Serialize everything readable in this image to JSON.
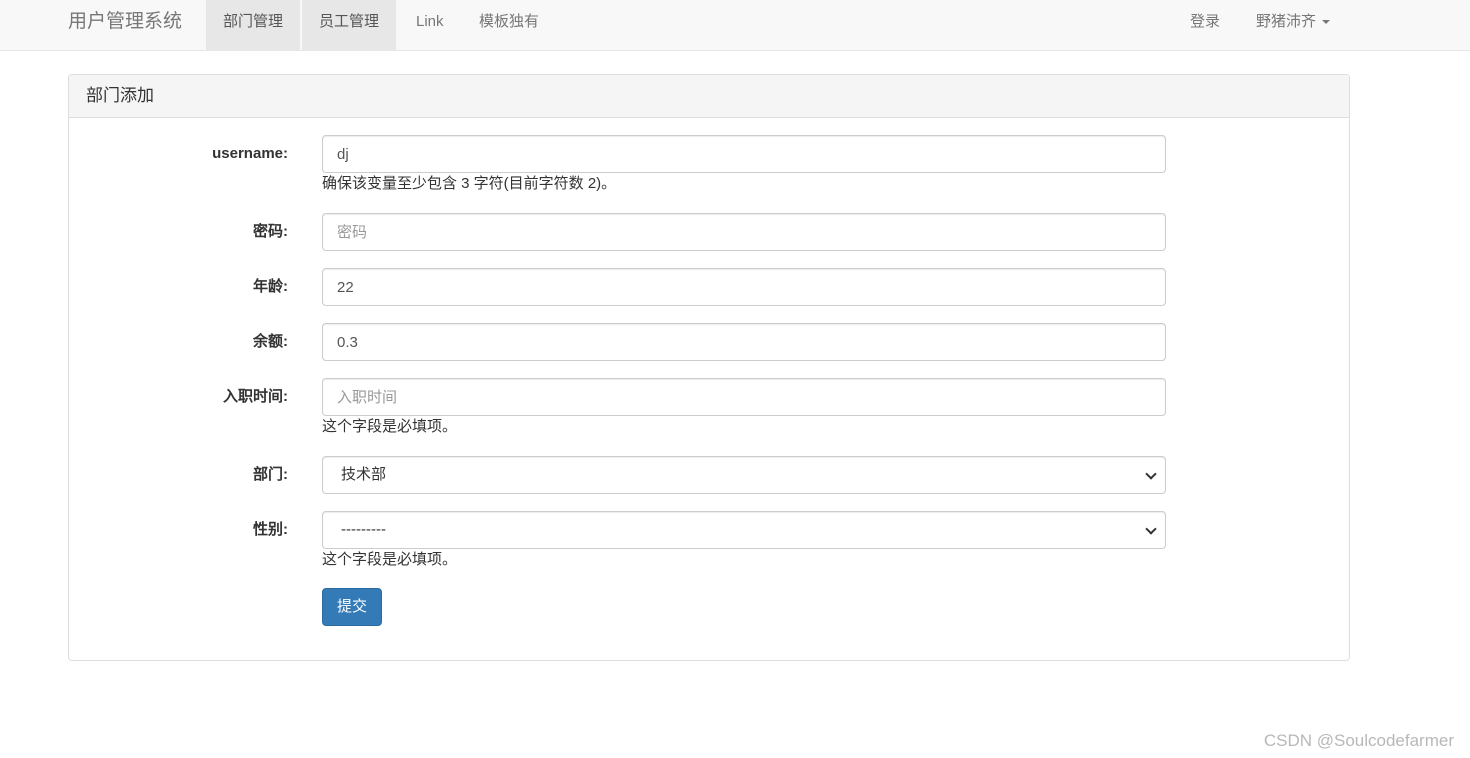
{
  "navbar": {
    "brand": "用户管理系统",
    "items": [
      {
        "label": "部门管理",
        "active": true
      },
      {
        "label": "员工管理",
        "active": true
      },
      {
        "label": "Link",
        "active": false
      },
      {
        "label": "模板独有",
        "active": false
      }
    ],
    "right": {
      "login": "登录",
      "user": "野猪沛齐"
    }
  },
  "panel": {
    "title": "部门添加"
  },
  "form": {
    "username": {
      "label": "username:",
      "value": "dj",
      "error": "确保该变量至少包含 3 字符(目前字符数 2)。"
    },
    "password": {
      "label": "密码:",
      "placeholder": "密码",
      "value": ""
    },
    "age": {
      "label": "年龄:",
      "value": "22"
    },
    "balance": {
      "label": "余额:",
      "value": "0.3"
    },
    "create_time": {
      "label": "入职时间:",
      "placeholder": "入职时间",
      "value": "",
      "error": "这个字段是必填项。"
    },
    "depart": {
      "label": "部门:",
      "selected": "技术部"
    },
    "gender": {
      "label": "性别:",
      "selected": "---------",
      "error": "这个字段是必填项。"
    },
    "submit_label": "提交"
  },
  "watermark": "CSDN @Soulcodefarmer",
  "colors": {
    "primary": "#337ab7",
    "navbar_bg": "#f8f8f8",
    "active_bg": "#e7e7e7"
  }
}
